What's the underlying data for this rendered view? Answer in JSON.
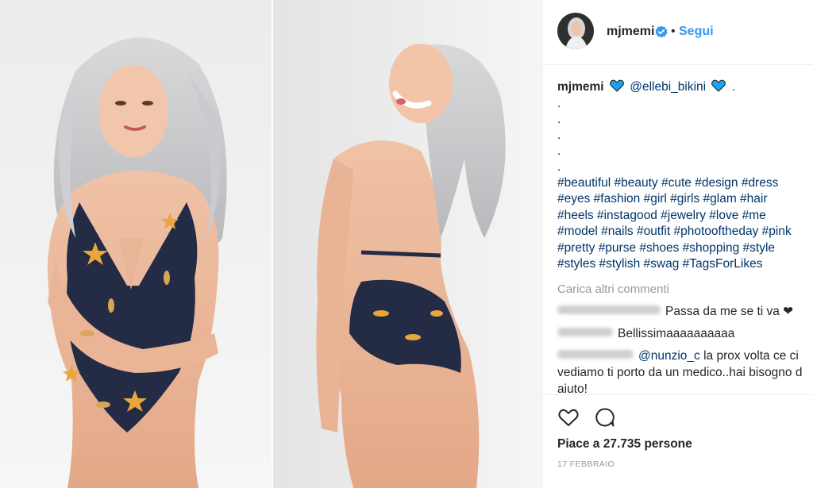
{
  "post": {
    "username": "mjmemi",
    "follow_label": "Segui",
    "separator": "•"
  },
  "caption": {
    "username": "mjmemi",
    "mention": "@ellebi_bikini",
    "trail": ".",
    "dots": [
      ".",
      ".",
      ".",
      ".",
      "."
    ],
    "hashtags": "#beautiful #beauty #cute #design #dress #eyes #fashion #girl #girls #glam #hair #heels #instagood #jewelry #love #me #model #nails #outfit #photooftheday #pink #pretty #purse #shoes #shopping #style #styles #stylish #swag #TagsForLikes"
  },
  "load_more_label": "Carica altri commenti",
  "comments": [
    {
      "text": "Passa da me se ti va ❤"
    },
    {
      "text": "Bellissimaaaaaaaaaa"
    },
    {
      "mention": "@nunzio_c",
      "text": " la prox volta ce ci vediamo ti porto da un medico..hai bisogno d aiuto!"
    }
  ],
  "likes_label": "Piace a 27.735 persone",
  "date_label": "17 FEBBRAIO",
  "colors": {
    "link": "#3897f0",
    "hashtag": "#003569",
    "emoji_heart": "#1da1f2",
    "muted": "#999999"
  },
  "icons": [
    "verified-badge-icon",
    "blue-heart-icon",
    "like-heart-icon",
    "comment-bubble-icon"
  ]
}
